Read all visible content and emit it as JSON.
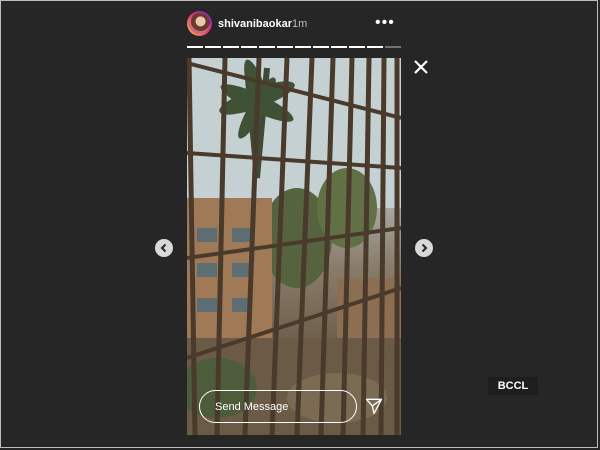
{
  "header": {
    "username": "shivanibaokar",
    "time": "1m",
    "more_icon": "more-horizontal-icon"
  },
  "progress": {
    "segments_total": 12,
    "segments_done": 11
  },
  "story": {
    "media_icon": "window-grille-photo"
  },
  "message": {
    "placeholder": "Send Message",
    "send_icon": "paper-plane-icon"
  },
  "navigation": {
    "prev_icon": "chevron-left-icon",
    "next_icon": "chevron-right-icon",
    "close_icon": "close-icon"
  },
  "watermark": {
    "text": "BCCL"
  },
  "colors": {
    "background": "#262626",
    "text": "#ffffff",
    "nav_button": "#d9d9d9"
  }
}
